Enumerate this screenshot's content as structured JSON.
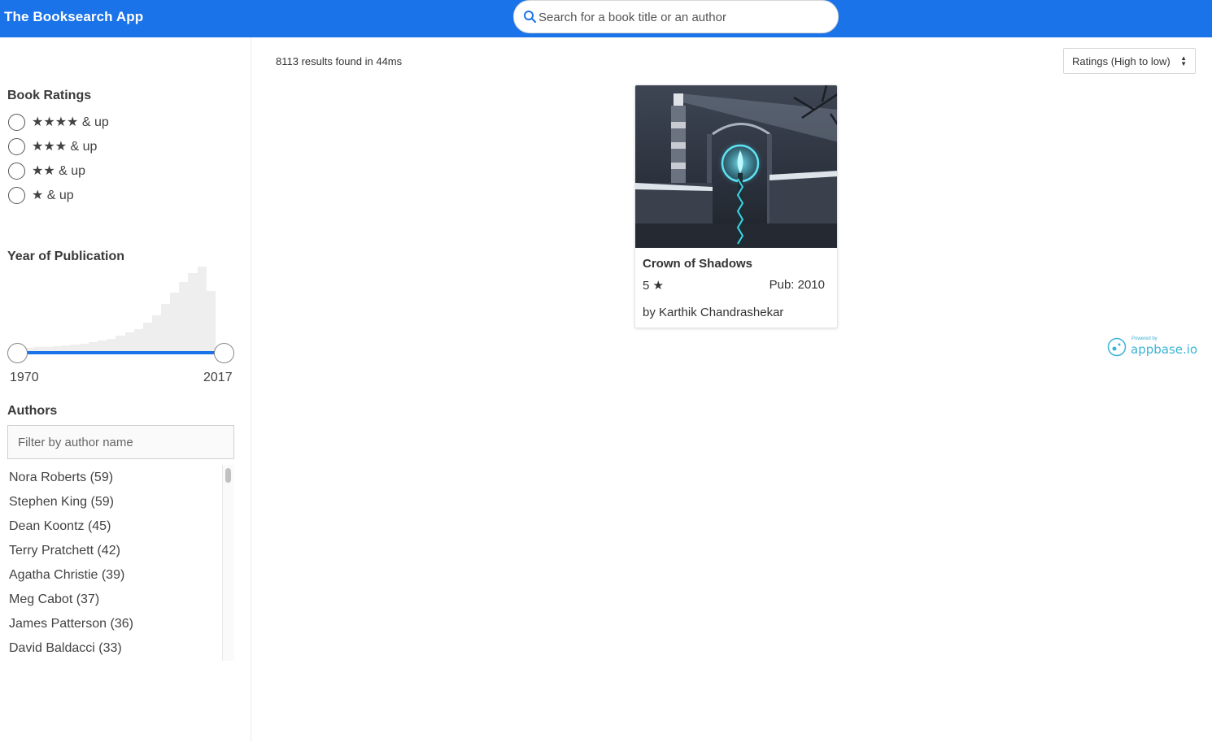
{
  "app": {
    "title": "The Booksearch App"
  },
  "search": {
    "placeholder": "Search for a book title or an author",
    "value": ""
  },
  "filters": {
    "ratings": {
      "title": "Book Ratings",
      "options": [
        {
          "label": "★★★★ & up",
          "selected": false
        },
        {
          "label": "★★★ & up",
          "selected": false
        },
        {
          "label": "★★ & up",
          "selected": false
        },
        {
          "label": "★ & up",
          "selected": false
        }
      ]
    },
    "year": {
      "title": "Year of Publication",
      "min_label": "1970",
      "max_label": "2017",
      "range": [
        1970,
        2017
      ],
      "histogram_levels": [
        0.07,
        0.07,
        0.08,
        0.08,
        0.09,
        0.1,
        0.11,
        0.12,
        0.14,
        0.16,
        0.18,
        0.21,
        0.25,
        0.29,
        0.36,
        0.44,
        0.57,
        0.7,
        0.82,
        0.93,
        1.0,
        0.72,
        0.08
      ]
    },
    "authors": {
      "title": "Authors",
      "placeholder": "Filter by author name",
      "items": [
        {
          "label": "Nora Roberts (59)"
        },
        {
          "label": "Stephen King (59)"
        },
        {
          "label": "Dean Koontz (45)"
        },
        {
          "label": "Terry Pratchett (42)"
        },
        {
          "label": "Agatha Christie (39)"
        },
        {
          "label": "Meg Cabot (37)"
        },
        {
          "label": "James Patterson (36)"
        },
        {
          "label": "David Baldacci (33)"
        }
      ]
    }
  },
  "results": {
    "summary": "8113 results found in 44ms",
    "sort_label": "Ratings (High to low)",
    "books": [
      {
        "title": "Crown of Shadows",
        "rating": "5 ★",
        "pub": "Pub: 2010",
        "author": "by Karthik Chandrashekar"
      }
    ]
  },
  "footer": {
    "powered_small": "Powered by",
    "powered_brand": "appbase.io"
  },
  "colors": {
    "primary": "#1a73e8",
    "brand_teal": "#3bb3d8",
    "histogram": "#eeeeee"
  }
}
